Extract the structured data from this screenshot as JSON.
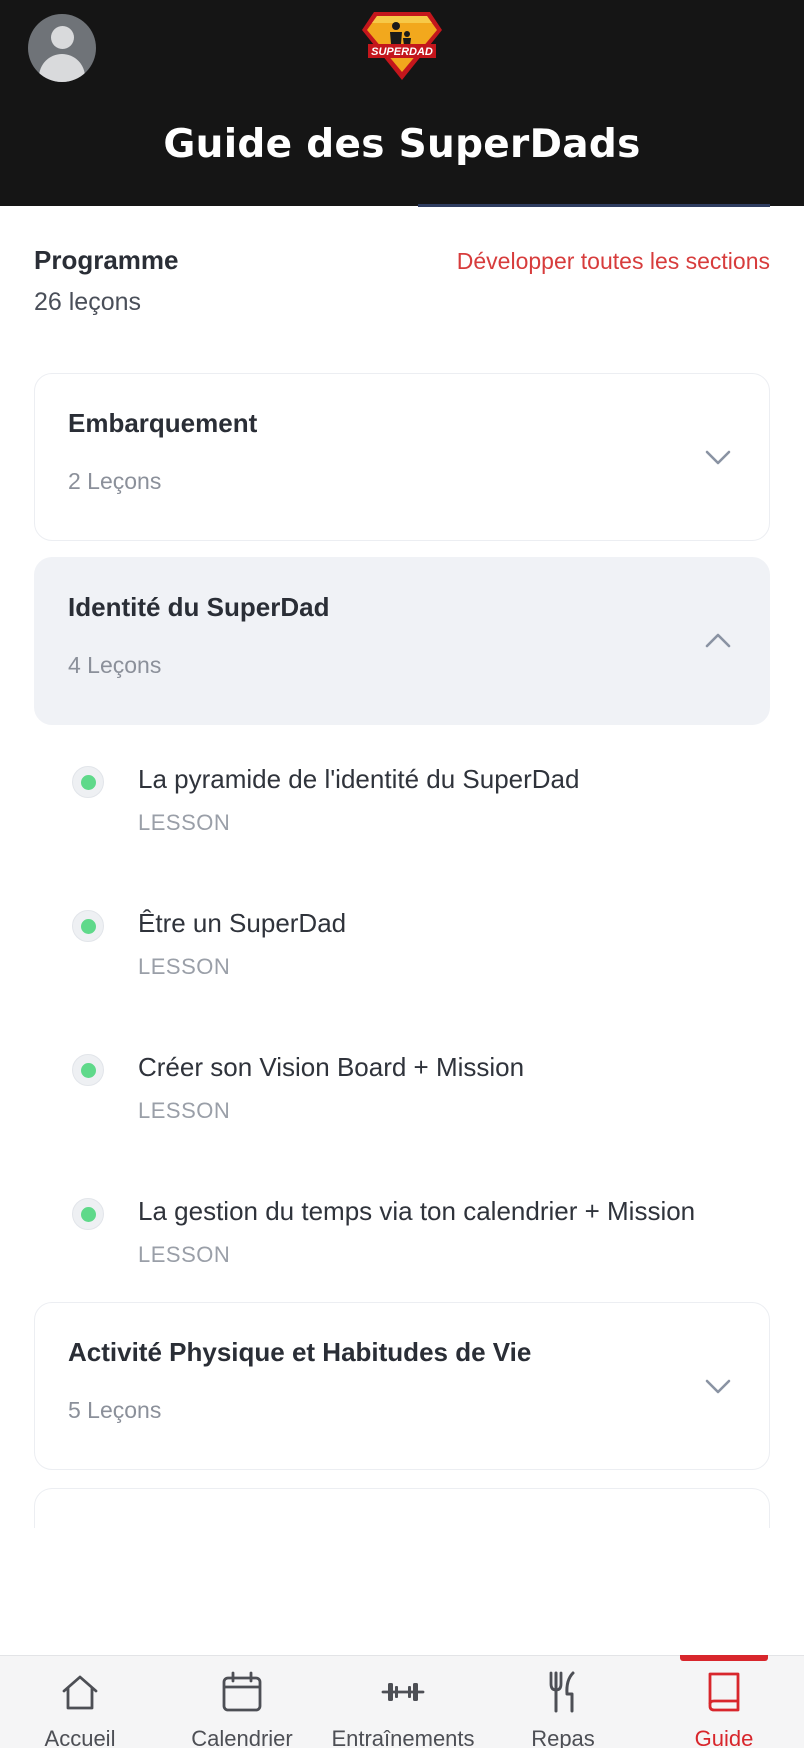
{
  "header": {
    "title": "Guide des SuperDads",
    "logo_text": "SUPERDAD"
  },
  "program": {
    "title": "Programme",
    "lesson_count": "26 leçons",
    "expand_all_label": "Développer toutes les sections"
  },
  "sections": [
    {
      "title": "Embarquement",
      "count": "2 Leçons",
      "expanded": false
    },
    {
      "title": "Identité du SuperDad",
      "count": "4 Leçons",
      "expanded": true
    },
    {
      "title": "Activité Physique et Habitudes de Vie",
      "count": "5 Leçons",
      "expanded": false
    }
  ],
  "lessons": [
    {
      "title": "La pyramide de l'identité du SuperDad",
      "type": "LESSON"
    },
    {
      "title": "Être un SuperDad",
      "type": "LESSON"
    },
    {
      "title": "Créer son Vision Board + Mission",
      "type": "LESSON"
    },
    {
      "title": "La gestion du temps via ton calendrier + Mission",
      "type": "LESSON"
    }
  ],
  "nav": {
    "items": [
      {
        "label": "Accueil",
        "icon": "home-icon"
      },
      {
        "label": "Calendrier",
        "icon": "calendar-icon"
      },
      {
        "label": "Entraînements",
        "icon": "dumbbell-icon"
      },
      {
        "label": "Repas",
        "icon": "fork-knife-icon"
      },
      {
        "label": "Guide",
        "icon": "book-icon"
      }
    ],
    "active": "Guide"
  },
  "colors": {
    "header_bg": "#151515",
    "accent_red": "#d73c3c",
    "nav_active": "#d8262c",
    "complete_dot": "#5fd98a",
    "open_section_bg": "#f0f2f6"
  }
}
